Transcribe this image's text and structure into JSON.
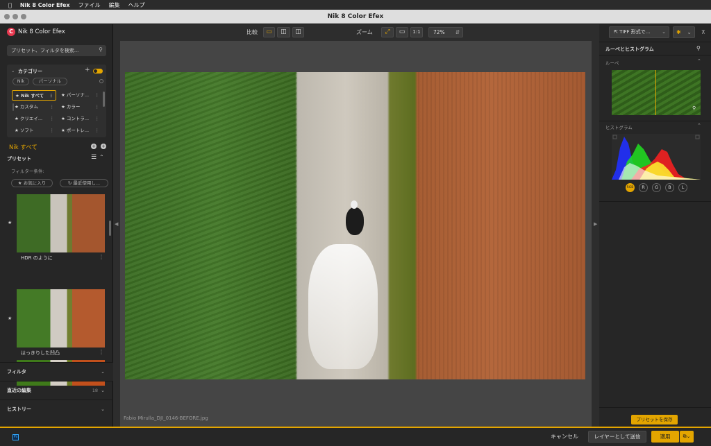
{
  "menubar": {
    "app": "Nik 8 Color Efex",
    "file": "ファイル",
    "edit": "編集",
    "help": "ヘルプ"
  },
  "window": {
    "title": "Nik 8 Color Efex"
  },
  "left": {
    "brand": "Nik 8 Color Efex",
    "search_placeholder": "プリセット、フィルタを検索...",
    "category_label": "カテゴリー",
    "chips": [
      "Nik",
      "パーソナル"
    ],
    "categories": [
      {
        "label": "Nik すべて",
        "selected": true
      },
      {
        "label": "パーソナ..."
      },
      {
        "label": "カスタム"
      },
      {
        "label": "カラー"
      },
      {
        "label": "クリエイ..."
      },
      {
        "label": "コントラ..."
      },
      {
        "label": "ソフト"
      },
      {
        "label": "ポートレ..."
      }
    ],
    "nik_all": "Nik すべて",
    "preset_label": "プリセット",
    "filter_cond": "フィルター条件:",
    "favorites": "お気に入り",
    "recent": "最近使用し...",
    "presets": [
      {
        "label": "HDR のように"
      },
      {
        "label": "はっきりした凹凸"
      },
      {
        "label": ""
      }
    ],
    "sections": [
      {
        "label": "フィルタ",
        "count": ""
      },
      {
        "label": "直近の編集",
        "count": "18"
      },
      {
        "label": "ヒストリー",
        "count": ""
      }
    ]
  },
  "toolbar": {
    "compare_label": "比較",
    "zoom_label": "ズーム",
    "one_to_one": "1:1",
    "zoom_value": "72%"
  },
  "filename": "Fabio Mirulla_DJI_0146-BEFORE.jpg",
  "right": {
    "export_label": "TIFF 形式で...",
    "panel_title": "ルーペとヒストグラム",
    "loupe_label": "ルーペ",
    "histogram_label": "ヒストグラム",
    "hist_buttons": [
      "RGB",
      "R",
      "G",
      "B",
      "L"
    ],
    "save_preset": "プリセットを保存"
  },
  "bottom": {
    "ps": "Ps",
    "cancel": "キャンセル",
    "send_layer": "レイヤーとして送信",
    "apply": "適用"
  },
  "colors": {
    "accent": "#e3a500",
    "brand": "#e8384f"
  }
}
